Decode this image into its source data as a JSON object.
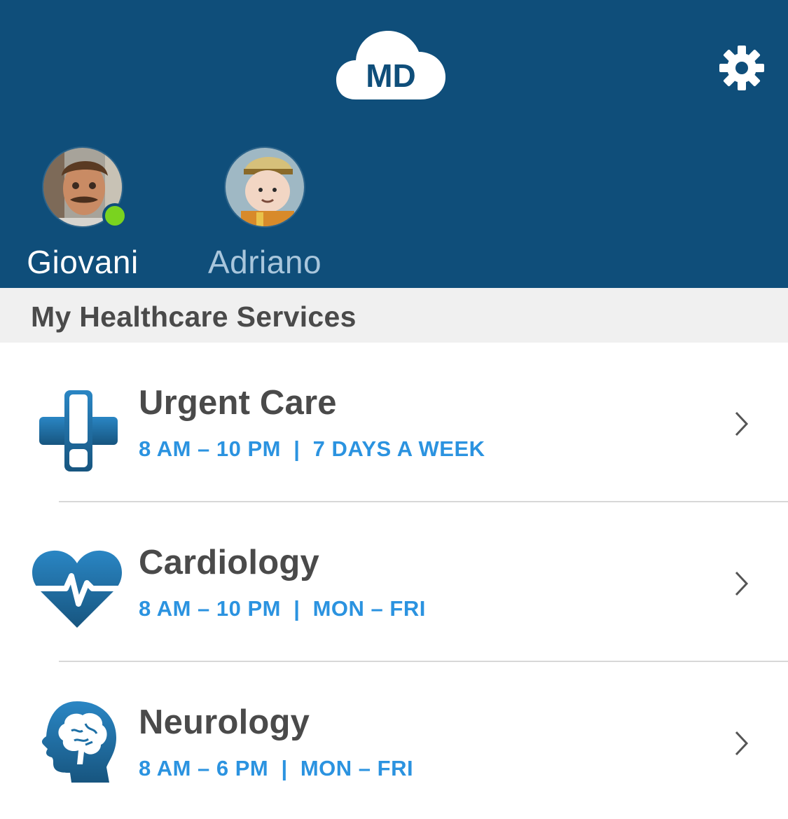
{
  "header": {
    "logo_text": "MD",
    "logo_icon": "cloud-icon",
    "settings_icon": "gear-icon",
    "background_color": "#0f4e7a"
  },
  "profiles": [
    {
      "name": "Giovani",
      "active": true,
      "online": true
    },
    {
      "name": "Adriano",
      "active": false,
      "online": false
    }
  ],
  "section": {
    "title": "My Healthcare Services"
  },
  "services": [
    {
      "title": "Urgent Care",
      "hours": "8 AM – 10 PM  |  7 DAYS A WEEK",
      "icon": "medical-cross-icon"
    },
    {
      "title": "Cardiology",
      "hours": "8 AM – 10 PM  |  MON – FRI",
      "icon": "heart-pulse-icon"
    },
    {
      "title": "Neurology",
      "hours": "8 AM – 6 PM  |  MON – FRI",
      "icon": "brain-head-icon"
    }
  ],
  "colors": {
    "accent_blue": "#2b93e0",
    "online_green": "#7ad31f",
    "icon_blue": "#1d6fa5"
  }
}
